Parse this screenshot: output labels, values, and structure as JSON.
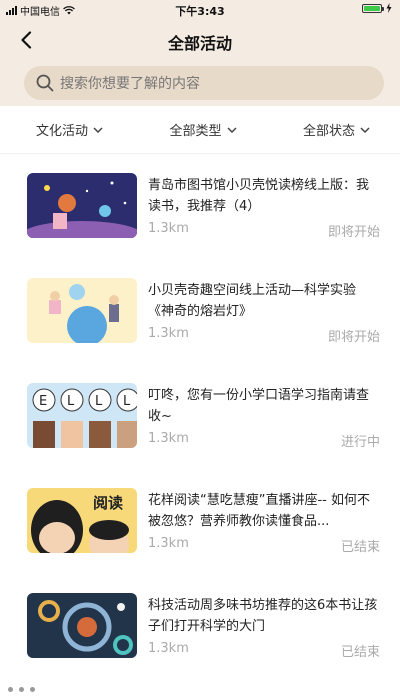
{
  "status_bar": {
    "carrier": "中国电信",
    "time": "下午3:43"
  },
  "nav": {
    "title": "全部活动"
  },
  "search": {
    "placeholder": "搜索你想要了解的内容"
  },
  "filters": [
    {
      "label": "文化活动"
    },
    {
      "label": "全部类型"
    },
    {
      "label": "全部状态"
    }
  ],
  "activities": [
    {
      "title": "青岛市图书馆小贝壳悦读榜线上版：我读书，我推荐（4）",
      "distance": "1.3km",
      "status": "即将开始",
      "thumb": "space-illustration"
    },
    {
      "title": "小贝壳奇趣空间线上活动—科学实验《神奇的熔岩灯》",
      "distance": "1.3km",
      "status": "即将开始",
      "thumb": "science-illustration"
    },
    {
      "title": "叮咚，您有一份小学口语学习指南请查收~",
      "distance": "1.3km",
      "status": "进行中",
      "thumb": "kids-letters-illustration"
    },
    {
      "title": "花样阅读“慧吃慧瘦”直播讲座-- 如何不被忽悠？营养师教你读懂食品...",
      "distance": "1.3km",
      "status": "已结束",
      "thumb": "reading-illustration",
      "thumb_text": "阅读"
    },
    {
      "title": "科技活动周多味书坊推荐的这6本书让孩子们打开科学的大门",
      "distance": "1.3km",
      "status": "已结束",
      "thumb": "tech-gears-illustration"
    }
  ],
  "colors": {
    "header_bg": "#f4ebe2",
    "search_bg": "#e8dac8",
    "muted": "#aaaaaa"
  }
}
